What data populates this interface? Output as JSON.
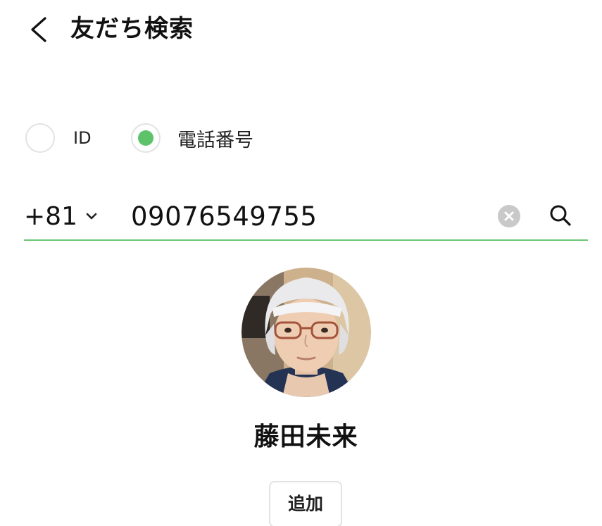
{
  "header": {
    "title": "友だち検索"
  },
  "search_type": {
    "options": [
      {
        "label": "ID",
        "selected": false
      },
      {
        "label": "電話番号",
        "selected": true
      }
    ]
  },
  "phone_search": {
    "country_code": "+81",
    "value": "09076549755"
  },
  "result": {
    "name": "藤田未来",
    "add_label": "追加"
  },
  "colors": {
    "accent": "#5ec26a",
    "underline": "#6cc779"
  }
}
